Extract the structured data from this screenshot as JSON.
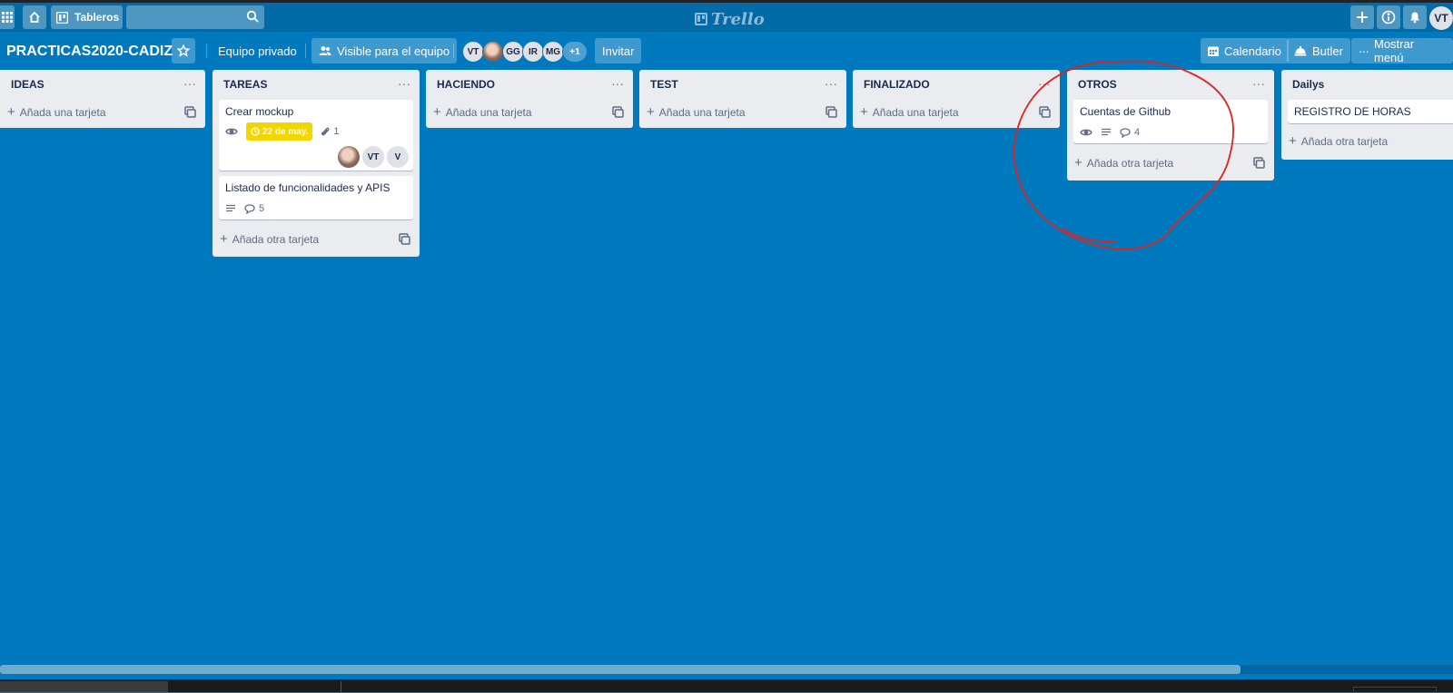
{
  "header": {
    "boards_label": "Tableros",
    "search": {
      "value": "",
      "placeholder": ""
    },
    "logo_text": "Trello",
    "user_initials": "VT"
  },
  "board": {
    "title": "PRACTICAS2020-CADIZ",
    "team_label": "Equipo privado",
    "visibility_label": "Visible para el equipo",
    "members": [
      "VT",
      "GG",
      "IR",
      "MG"
    ],
    "more_members": "+1",
    "invite_label": "Invitar",
    "calendar_label": "Calendario",
    "butler_label": "Butler",
    "menu_label": "Mostrar menú"
  },
  "lists": [
    {
      "title": "IDEAS",
      "add_label": "Añada una tarjeta"
    },
    {
      "title": "TAREAS",
      "add_label": "Añada otra tarjeta",
      "cards": [
        {
          "title": "Crear mockup",
          "due": "22 de may.",
          "attachments": "1",
          "members": [
            "VT",
            "V"
          ]
        },
        {
          "title": "Listado de funcionalidades y APIS",
          "comments": "5"
        }
      ]
    },
    {
      "title": "HACIENDO",
      "add_label": "Añada una tarjeta"
    },
    {
      "title": "TEST",
      "add_label": "Añada una tarjeta"
    },
    {
      "title": "FINALIZADO",
      "add_label": "Añada una tarjeta"
    },
    {
      "title": "OTROS",
      "add_label": "Añada otra tarjeta",
      "cards": [
        {
          "title": "Cuentas de Github",
          "comments": "4"
        }
      ]
    },
    {
      "title": "Dailys",
      "add_label": "Añada otra tarjeta",
      "cards": [
        {
          "title": "REGISTRO DE HORAS"
        }
      ]
    }
  ],
  "annotation": {
    "color": "#e0221b"
  },
  "colors": {
    "board_bg": "#0079bf",
    "header_bg": "#026aa7",
    "list_bg": "#ebecf0",
    "due_badge": "#f2d600"
  }
}
